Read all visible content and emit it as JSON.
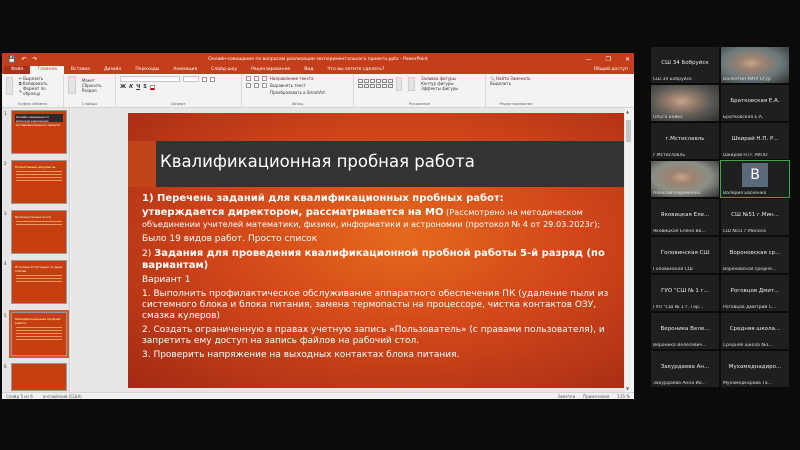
{
  "powerpoint": {
    "window_title": "Онлайн-совещание по вопросам реализации экспериментального проекта.pptx  -  PowerPoint",
    "qat_icons": [
      "save-icon",
      "undo-icon",
      "redo-icon"
    ],
    "window_buttons": [
      "—",
      "❐",
      "✕"
    ],
    "tabs": [
      "Файл",
      "Главная",
      "Вставка",
      "Дизайн",
      "Переходы",
      "Анимация",
      "Слайд-шоу",
      "Рецензирование",
      "Вид",
      "Что вы хотите сделать?"
    ],
    "account": "Общий доступ",
    "ribbon": {
      "clipboard": {
        "paste": "Вставить",
        "cut": "Вырезать",
        "copy": "Копировать",
        "format": "Формат по образцу",
        "label": "Буфер обмена"
      },
      "slides": {
        "new": "Создать слайд",
        "layout": "Макет",
        "reset": "Сбросить",
        "section": "Раздел",
        "label": "Слайды"
      },
      "font": {
        "label": "Шрифт"
      },
      "paragraph": {
        "direction": "Направление текста",
        "align": "Выровнять текст",
        "smartart": "Преобразовать в SmartArt",
        "label": "Абзац"
      },
      "drawing": {
        "arrange": "Упорядочить",
        "styles": "Экспресс-стили",
        "fill": "Заливка фигуры",
        "outline": "Контур фигуры",
        "effects": "Эффекты фигуры",
        "label": "Рисование"
      },
      "editing": {
        "find": "Найти",
        "replace": "Заменить",
        "select": "Выделить",
        "label": "Редактирование"
      }
    },
    "thumbnails": [
      {
        "num": "1",
        "title": "Онлайн-совещание по вопросам реализации экспериментального проекта"
      },
      {
        "num": "2",
        "title": "Нормативные документы"
      },
      {
        "num": "3",
        "title": "Промежуточные итоги"
      },
      {
        "num": "4",
        "title": "Итоговая аттестация по двум этапам"
      },
      {
        "num": "5",
        "title": "Квалификационная пробная работа"
      },
      {
        "num": "6",
        "title": ""
      }
    ],
    "slide": {
      "title": "Квалификационная пробная работа",
      "p1": "1) Перечень заданий для квалификационных пробных работ:",
      "p2_bold": "утверждается директором, рассматривается на МО",
      "p2_rest": " (Рассмотрено на методическом объединении учителей математики, физики, информатики и астрономии (протокол № 4 от 29.03.2023г);",
      "p3": "Было 19 видов работ. Просто список",
      "p4_prefix": "2) ",
      "p4_bold": "Задания для проведения квалификационной пробной работы 5-й разряд (по вариантам)",
      "p5": "Вариант 1",
      "p6": "1. Выполнить профилактическое обслуживание аппаратного обеспечения ПК (удаление пыли из системного блока и блока питания, замена термопасты на процессоре, чистка контактов ОЗУ, смазка кулеров)",
      "p7": "2. Создать ограниченную в правах учетную запись «Пользователь» (с правами пользователя), и запретить ему доступ на запись файлов на рабочий стол.",
      "p8": "3. Проверить напряжение на выходных контактах блока питания."
    },
    "status": {
      "slide": "Слайд 5 из 6",
      "lang": "английский (США)",
      "notes": "Заметки",
      "comments": "Примечания",
      "zoom": "115 %"
    }
  },
  "participants": [
    {
      "name": "СШ 34 Бобруйск",
      "label": "СШ 34 Бобруйск",
      "photo": false
    },
    {
      "name": "",
      "label": "Валентин УИП! Егур",
      "photo": true
    },
    {
      "name": "",
      "label": "Ольга Бойко",
      "photo": true
    },
    {
      "name": "Братковская Е.А.",
      "label": "Братковская Е.А.",
      "photo": false
    },
    {
      "name": "г.Мстиславль",
      "label": "г.Мстиславль",
      "photo": false
    },
    {
      "name": "Шкирай Н.П. Р...",
      "label": "Шкирай Н.П. РИПО",
      "photo": false
    },
    {
      "name": "",
      "label": "Алексей Окременко",
      "photo": true
    },
    {
      "name": "",
      "label": "Валерия Евсеенко",
      "photo": false,
      "avatar": "В"
    },
    {
      "name": "Яковицкая Еле...",
      "label": "Яковицкая Елена Ва...",
      "photo": false
    },
    {
      "name": "СШ №51 г.Мин...",
      "label": "СШ №51 г.Минска",
      "photo": false
    },
    {
      "name": "Головинская СШ",
      "label": "Головинская СШ",
      "photo": false
    },
    {
      "name": "Вороновская ср...",
      "label": "Вороновская средня...",
      "photo": false
    },
    {
      "name": "ГУО \"СШ № 1 г...",
      "label": "ГУО \"СШ № 1 г. Гор...",
      "photo": false
    },
    {
      "name": "Роговцов Дмит...",
      "label": "Роговцов Дмитрий С...",
      "photo": false
    },
    {
      "name": "Вероника Веле...",
      "label": "Вероника Велесевич...",
      "photo": false
    },
    {
      "name": "Средняя школа...",
      "label": "Средняя школа №1...",
      "photo": false
    },
    {
      "name": "Закурдаева Ан...",
      "label": "Закурдаева Анна Ио...",
      "photo": false
    },
    {
      "name": "Мухамеднадиро...",
      "label": "Мухамедкарова Та...",
      "photo": false
    }
  ]
}
